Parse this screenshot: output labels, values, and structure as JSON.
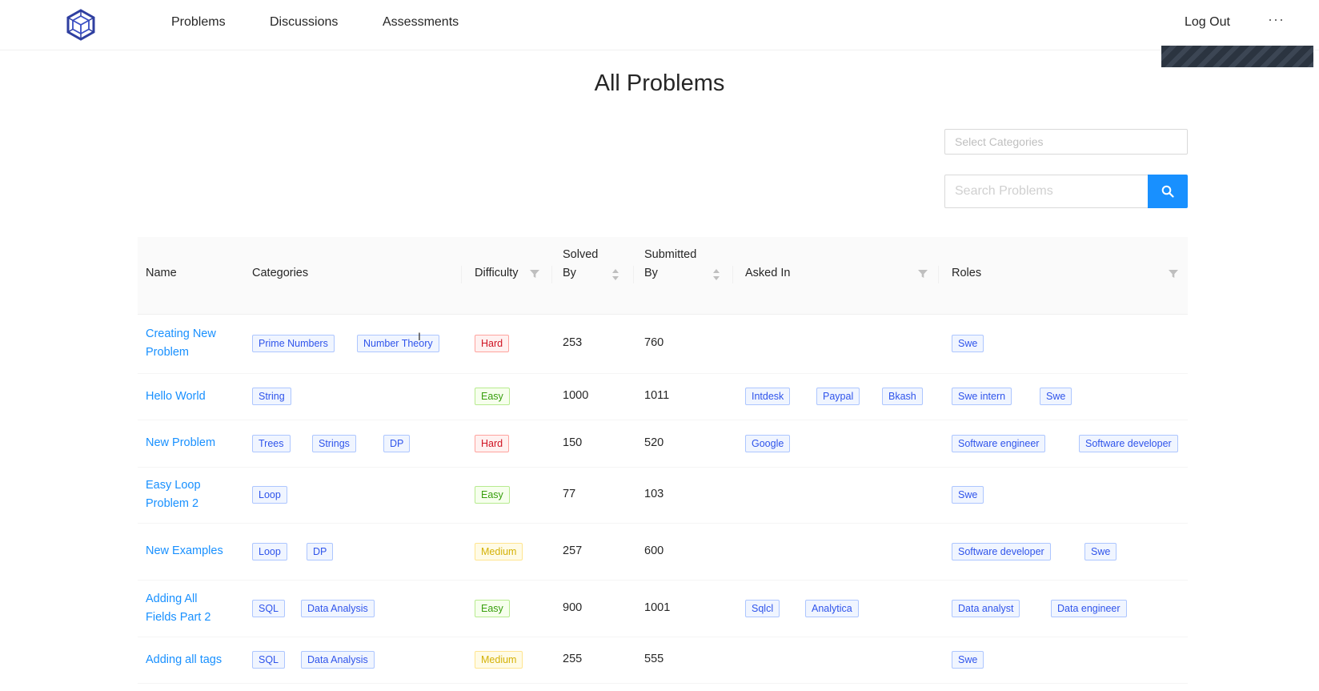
{
  "nav": {
    "items": [
      "Problems",
      "Discussions",
      "Assessments"
    ],
    "logout": "Log Out",
    "more": "···"
  },
  "page": {
    "title": "All Problems"
  },
  "filters": {
    "categories_placeholder": "Select Categories",
    "search_placeholder": "Search Problems"
  },
  "table": {
    "headers": {
      "name": "Name",
      "categories": "Categories",
      "difficulty": "Difficulty",
      "solved_by": [
        "Solved",
        "By"
      ],
      "submitted_by": [
        "Submitted",
        "By"
      ],
      "asked_in": "Asked In",
      "roles": "Roles"
    },
    "rows": [
      {
        "name": [
          "Creating New",
          "Problem"
        ],
        "categories": [
          "Prime Numbers",
          "Number Theory"
        ],
        "difficulty": "Hard",
        "solved_by": "253",
        "submitted_by": "760",
        "asked_in": [],
        "roles": [
          "Swe"
        ]
      },
      {
        "name": [
          "Hello World"
        ],
        "categories": [
          "String"
        ],
        "difficulty": "Easy",
        "solved_by": "1000",
        "submitted_by": "1011",
        "asked_in": [
          "Intdesk",
          "Paypal",
          "Bkash"
        ],
        "roles": [
          "Swe intern",
          "Swe"
        ]
      },
      {
        "name": [
          "New Problem"
        ],
        "categories": [
          "Trees",
          "Strings",
          "DP"
        ],
        "difficulty": "Hard",
        "solved_by": "150",
        "submitted_by": "520",
        "asked_in": [
          "Google"
        ],
        "roles": [
          "Software engineer",
          "Software developer"
        ]
      },
      {
        "name": [
          "Easy Loop",
          "Problem 2"
        ],
        "categories": [
          "Loop"
        ],
        "difficulty": "Easy",
        "solved_by": "77",
        "submitted_by": "103",
        "asked_in": [],
        "roles": [
          "Swe"
        ]
      },
      {
        "name": [
          "New Examples"
        ],
        "categories": [
          "Loop",
          "DP"
        ],
        "difficulty": "Medium",
        "solved_by": "257",
        "submitted_by": "600",
        "asked_in": [],
        "roles": [
          "Software developer",
          "Swe"
        ]
      },
      {
        "name": [
          "Adding All",
          "Fields Part 2"
        ],
        "categories": [
          "SQL",
          "Data Analysis"
        ],
        "difficulty": "Easy",
        "solved_by": "900",
        "submitted_by": "1001",
        "asked_in": [
          "Sqlcl",
          "Analytica"
        ],
        "roles": [
          "Data analyst",
          "Data engineer"
        ]
      },
      {
        "name": [
          "Adding all tags"
        ],
        "categories": [
          "SQL",
          "Data Analysis"
        ],
        "difficulty": "Medium",
        "solved_by": "255",
        "submitted_by": "555",
        "asked_in": [],
        "roles": [
          "Swe"
        ]
      }
    ]
  },
  "colors": {
    "link": "#1890ff",
    "search_button": "#1890ff",
    "hard": "#cf1322",
    "easy": "#389e0d",
    "medium": "#d4b106",
    "tag": "#2f54eb"
  },
  "icons": {
    "logo": "cube-logo-icon",
    "search": "search-icon",
    "filter": "filter-icon",
    "sort": "sort-icon",
    "more": "ellipsis-icon"
  }
}
